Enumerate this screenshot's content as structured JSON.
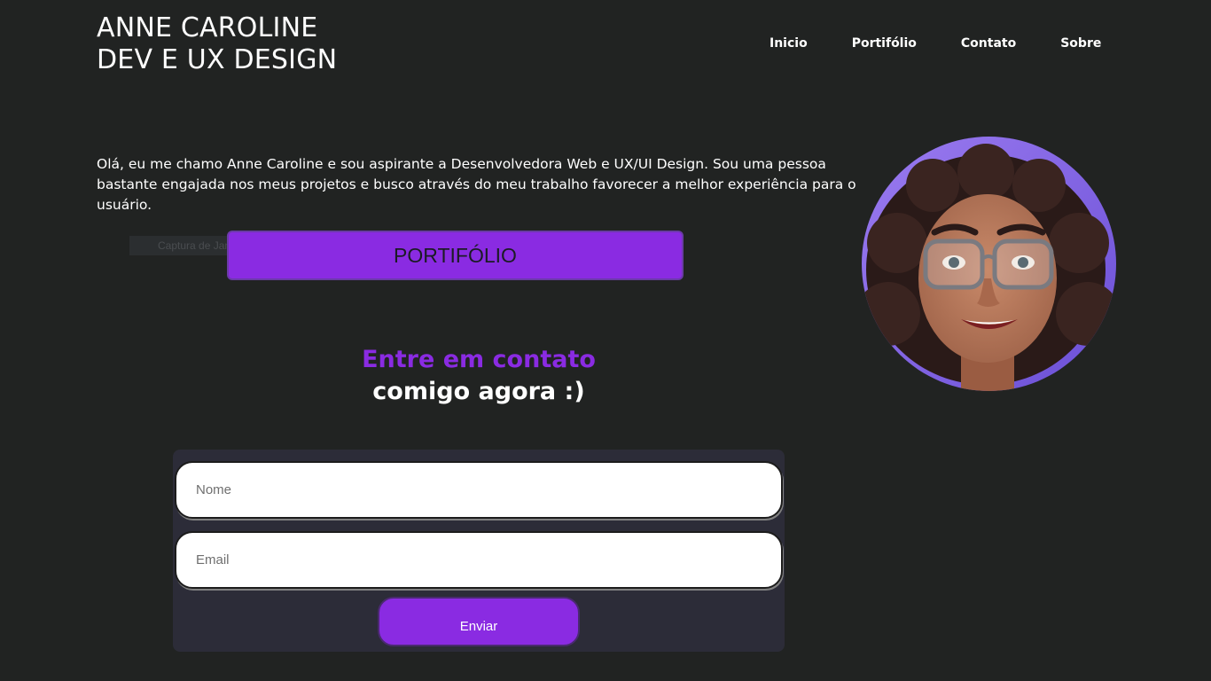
{
  "header": {
    "brand_line1": "ANNE CAROLINE",
    "brand_line2": "DEV E UX DESIGN"
  },
  "nav": {
    "items": [
      {
        "label": "Inicio"
      },
      {
        "label": "Portifólio"
      },
      {
        "label": "Contato"
      },
      {
        "label": "Sobre"
      }
    ]
  },
  "hero": {
    "intro": "Olá, eu me chamo Anne Caroline e sou aspirante a Desenvolvedora Web e UX/UI Design. Sou uma pessoa bastante engajada nos meus projetos e busco através do meu trabalho favorecer a melhor experiência para o usuário.",
    "portfolio_button": "PORTIFÓLIO",
    "tooltip": "Captura de Janela",
    "avatar_icon": "avatar-illustration"
  },
  "contact": {
    "heading_accent": "Entre em contato",
    "heading_rest": "comigo agora :)",
    "name_placeholder": "Nome",
    "email_placeholder": "Email",
    "submit_label": "Enviar"
  },
  "colors": {
    "background": "#212322",
    "accent": "#8a2be2",
    "form_bg": "#2c2c38"
  }
}
